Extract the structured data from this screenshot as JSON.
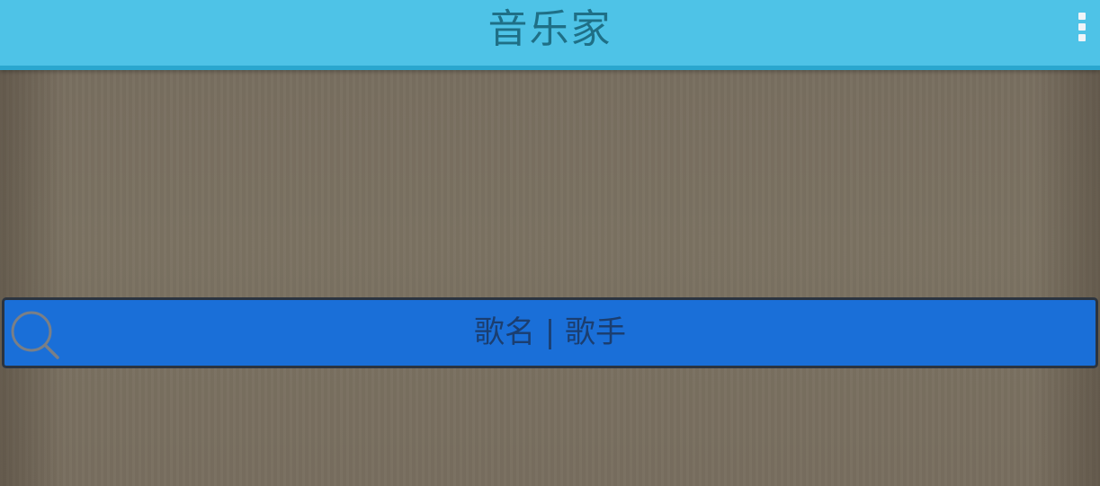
{
  "app": {
    "title": "音乐家"
  },
  "toolbar": {
    "overflow_icon": "more-vertical-icon"
  },
  "search": {
    "label": "歌名 | 歌手",
    "icon": "search-icon"
  },
  "colors": {
    "appbar": "#4ec3e7",
    "appbar_border": "#2aa7cf",
    "title_text": "#1f6f86",
    "search_bg": "#1a6fd8",
    "search_text": "#1b3e70",
    "search_icon": "#7a7f86",
    "background": "#7a7060"
  }
}
